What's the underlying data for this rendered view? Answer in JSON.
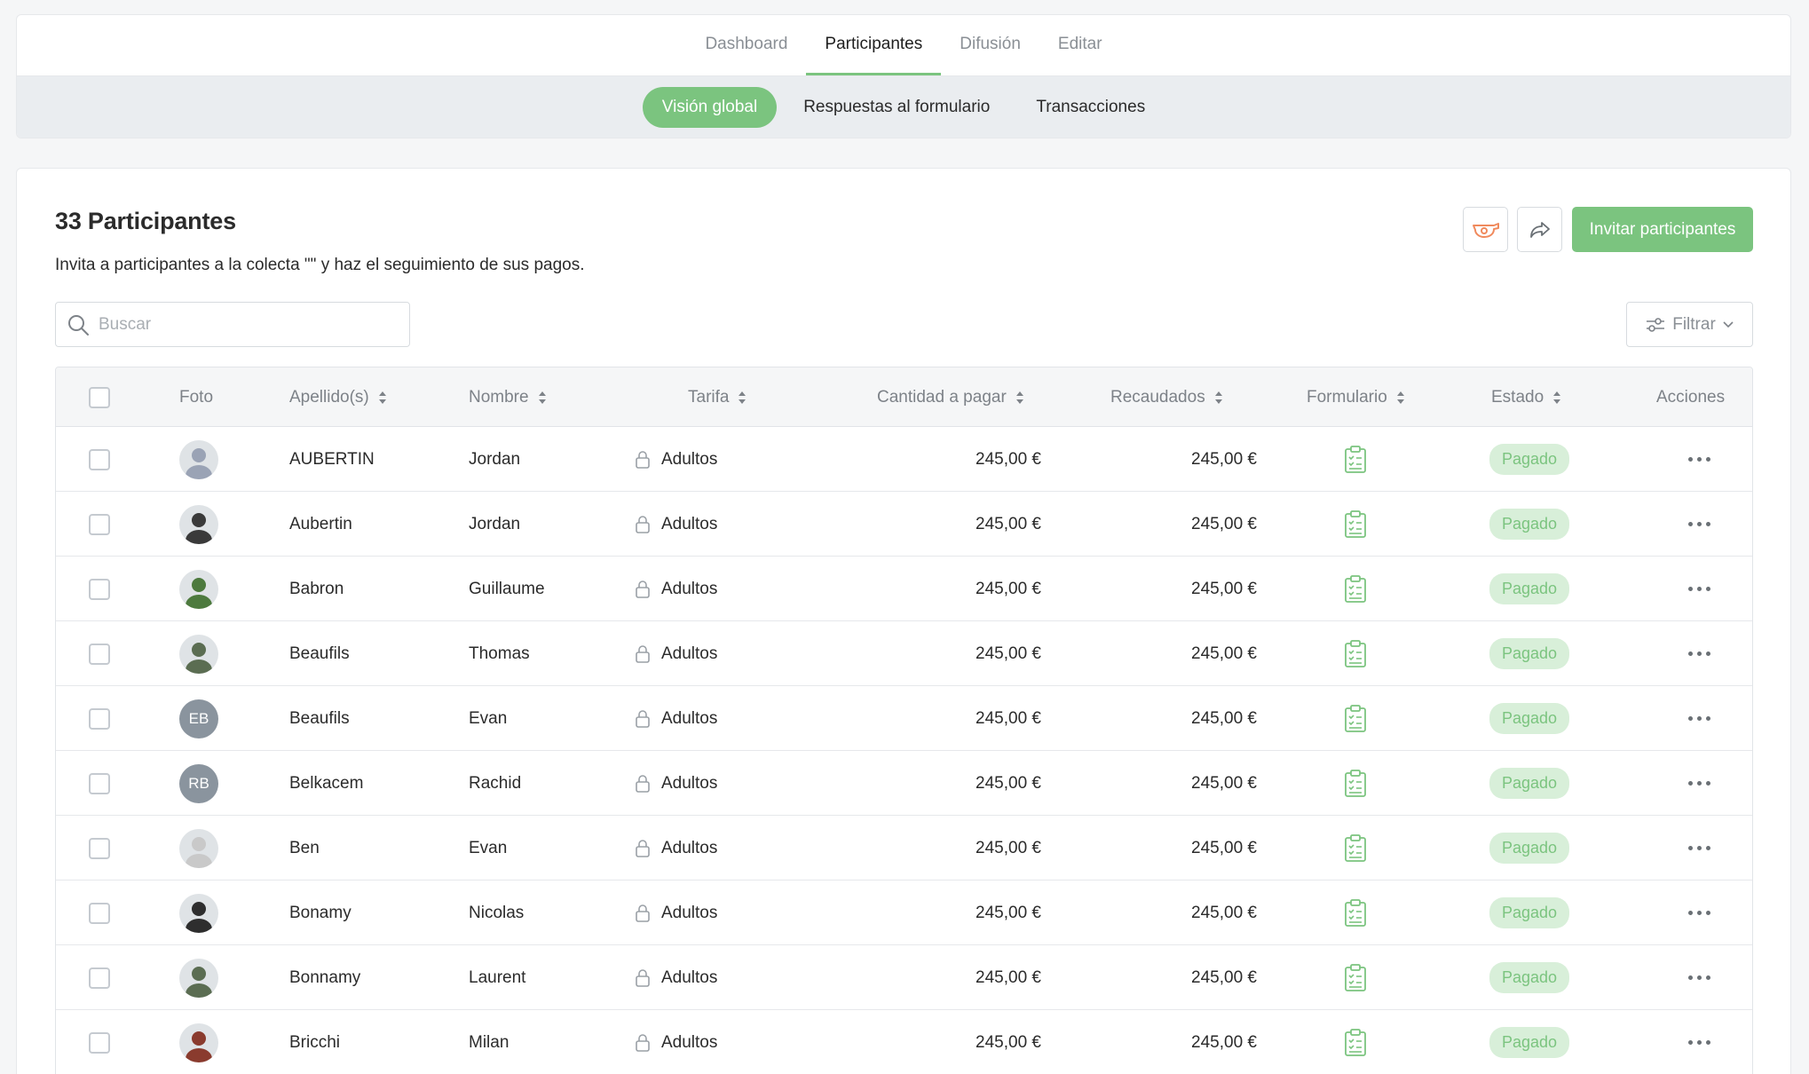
{
  "nav": {
    "tabs": [
      {
        "label": "Dashboard"
      },
      {
        "label": "Participantes"
      },
      {
        "label": "Difusión"
      },
      {
        "label": "Editar"
      }
    ],
    "active_tab": "Participantes",
    "subtabs": [
      {
        "label": "Visión global"
      },
      {
        "label": "Respuestas al formulario"
      },
      {
        "label": "Transacciones"
      }
    ],
    "active_subtab": "Visión global"
  },
  "header": {
    "title": "33 Participantes",
    "subtitle": "Invita a participantes a la colecta \"\" y haz el seguimiento de sus pagos.",
    "invite_label": "Invitar participantes"
  },
  "search": {
    "placeholder": "Buscar"
  },
  "filter": {
    "label": "Filtrar"
  },
  "colors": {
    "accent": "#7bc47f",
    "badge_bg": "#d8efd9",
    "whistle": "#f08a5d"
  },
  "table": {
    "columns": [
      {
        "label": "Foto"
      },
      {
        "label": "Apellido(s)"
      },
      {
        "label": "Nombre"
      },
      {
        "label": "Tarifa"
      },
      {
        "label": "Cantidad a pagar"
      },
      {
        "label": "Recaudados"
      },
      {
        "label": "Formulario"
      },
      {
        "label": "Estado"
      },
      {
        "label": "Acciones"
      }
    ],
    "rows": [
      {
        "apellido": "AUBERTIN",
        "nombre": "Jordan",
        "tarifa": "Adultos",
        "cantidad": "245,00 €",
        "recaudados": "245,00 €",
        "estado": "Pagado",
        "photo": "photo",
        "photo_color": "#9aa3b5",
        "initials": ""
      },
      {
        "apellido": "Aubertin",
        "nombre": "Jordan",
        "tarifa": "Adultos",
        "cantidad": "245,00 €",
        "recaudados": "245,00 €",
        "estado": "Pagado",
        "photo": "photo",
        "photo_color": "#3a3a3a",
        "initials": ""
      },
      {
        "apellido": "Babron",
        "nombre": "Guillaume",
        "tarifa": "Adultos",
        "cantidad": "245,00 €",
        "recaudados": "245,00 €",
        "estado": "Pagado",
        "photo": "photo",
        "photo_color": "#4d7a3e",
        "initials": ""
      },
      {
        "apellido": "Beaufils",
        "nombre": "Thomas",
        "tarifa": "Adultos",
        "cantidad": "245,00 €",
        "recaudados": "245,00 €",
        "estado": "Pagado",
        "photo": "photo",
        "photo_color": "#5b6d52",
        "initials": ""
      },
      {
        "apellido": "Beaufils",
        "nombre": "Evan",
        "tarifa": "Adultos",
        "cantidad": "245,00 €",
        "recaudados": "245,00 €",
        "estado": "Pagado",
        "photo": "initials",
        "photo_color": "#8a949e",
        "initials": "EB"
      },
      {
        "apellido": "Belkacem",
        "nombre": "Rachid",
        "tarifa": "Adultos",
        "cantidad": "245,00 €",
        "recaudados": "245,00 €",
        "estado": "Pagado",
        "photo": "initials",
        "photo_color": "#8a949e",
        "initials": "RB"
      },
      {
        "apellido": "Ben",
        "nombre": "Evan",
        "tarifa": "Adultos",
        "cantidad": "245,00 €",
        "recaudados": "245,00 €",
        "estado": "Pagado",
        "photo": "photo",
        "photo_color": "#c9c9c9",
        "initials": ""
      },
      {
        "apellido": "Bonamy",
        "nombre": "Nicolas",
        "tarifa": "Adultos",
        "cantidad": "245,00 €",
        "recaudados": "245,00 €",
        "estado": "Pagado",
        "photo": "photo",
        "photo_color": "#2e2e2e",
        "initials": ""
      },
      {
        "apellido": "Bonnamy",
        "nombre": "Laurent",
        "tarifa": "Adultos",
        "cantidad": "245,00 €",
        "recaudados": "245,00 €",
        "estado": "Pagado",
        "photo": "photo",
        "photo_color": "#5b6d52",
        "initials": ""
      },
      {
        "apellido": "Bricchi",
        "nombre": "Milan",
        "tarifa": "Adultos",
        "cantidad": "245,00 €",
        "recaudados": "245,00 €",
        "estado": "Pagado",
        "photo": "photo",
        "photo_color": "#8a3b2e",
        "initials": ""
      }
    ]
  }
}
